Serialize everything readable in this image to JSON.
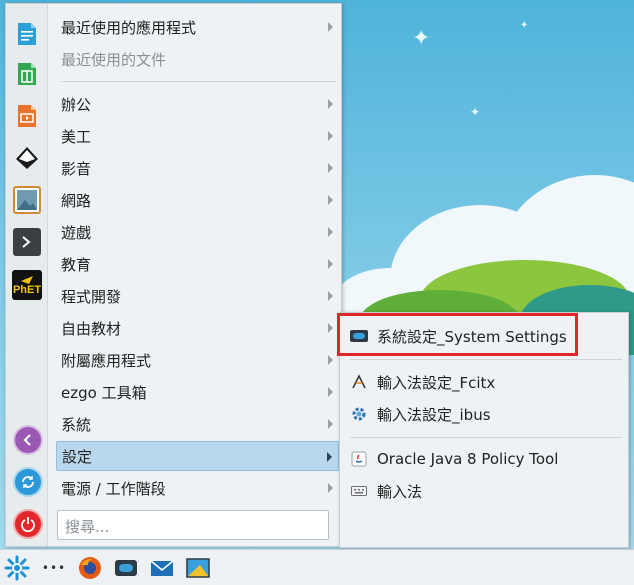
{
  "menu": {
    "items": [
      {
        "label": "最近使用的應用程式",
        "has_submenu": true
      },
      {
        "label": "最近使用的文件",
        "disabled": true
      },
      {
        "label": "辦公",
        "has_submenu": true
      },
      {
        "label": "美工",
        "has_submenu": true
      },
      {
        "label": "影音",
        "has_submenu": true
      },
      {
        "label": "網路",
        "has_submenu": true
      },
      {
        "label": "遊戲",
        "has_submenu": true
      },
      {
        "label": "教育",
        "has_submenu": true
      },
      {
        "label": "程式開發",
        "has_submenu": true
      },
      {
        "label": "自由教材",
        "has_submenu": true
      },
      {
        "label": "附屬應用程式",
        "has_submenu": true
      },
      {
        "label": "ezgo 工具箱",
        "has_submenu": true
      },
      {
        "label": "系統",
        "has_submenu": true
      },
      {
        "label": "設定",
        "has_submenu": true,
        "selected": true
      },
      {
        "label": "電源 / 工作階段",
        "has_submenu": true
      }
    ],
    "search_placeholder": "搜尋...",
    "favorites": [
      "libreoffice-writer-icon",
      "libreoffice-calc-icon",
      "libreoffice-impress-icon",
      "inkscape-icon",
      "image-viewer-icon",
      "terminal-icon",
      "phet-icon"
    ],
    "phet_label": "PhET",
    "session_buttons": [
      "logout-icon",
      "switch-user-icon",
      "power-icon"
    ]
  },
  "submenu": {
    "items": [
      {
        "label": "系統設定_System Settings",
        "icon": "system-settings-icon",
        "highlighted": true
      },
      {
        "label": "輸入法設定_Fcitx",
        "icon": "fcitx-icon"
      },
      {
        "label": "輸入法設定_ibus",
        "icon": "ibus-gear-icon"
      },
      {
        "label": "Oracle Java 8 Policy Tool",
        "icon": "java-icon"
      },
      {
        "label": "輸入法",
        "icon": "keyboard-icon"
      }
    ]
  },
  "taskbar": {
    "items": [
      "application-launcher-icon",
      "more-icon",
      "firefox-icon",
      "system-settings-icon",
      "mail-icon",
      "screenshot-icon"
    ],
    "more_label": "•••"
  },
  "colors": {
    "highlight_border": "#e0252b",
    "selection": "#b9d8ee",
    "menu_bg": "#eef2f4"
  }
}
